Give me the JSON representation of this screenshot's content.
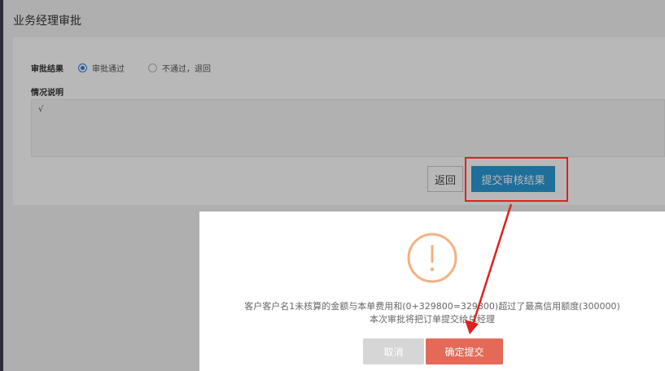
{
  "page": {
    "title": "业务经理审批"
  },
  "form": {
    "result_label": "审批结果",
    "options": [
      {
        "label": "审批通过",
        "checked": true
      },
      {
        "label": "不通过，退回",
        "checked": false
      }
    ],
    "remark_label": "情况说明",
    "remark_value": "√"
  },
  "actions": {
    "back_label": "返回",
    "submit_label": "提交审核结果"
  },
  "dialog": {
    "line1": "客户客户名1未核算的金额与本单费用和(0+329800=329800)超过了最高信用额度(300000)",
    "line2": "本次审批将把订单提交给总经理",
    "cancel_label": "取消",
    "confirm_label": "确定提交"
  },
  "colors": {
    "primary": "#2a9ad6",
    "confirm": "#e46a57",
    "warning": "#f4b183",
    "annotation": "#e02020"
  }
}
